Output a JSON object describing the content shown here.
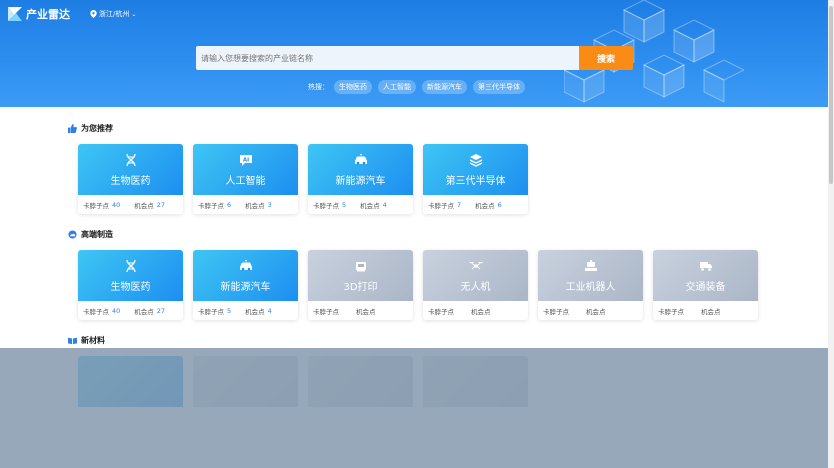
{
  "header": {
    "app_name": "产业雷达",
    "location": "浙江/杭州",
    "search_placeholder": "请输入您想要搜索的产业链名称",
    "search_button": "搜索",
    "hot_label": "热搜：",
    "hot_tags": [
      "生物医药",
      "人工智能",
      "新能源汽车",
      "第三代半导体"
    ]
  },
  "sections": [
    {
      "title": "为您推荐",
      "icon": "thumbs-up-icon",
      "cards": [
        {
          "name": "生物医药",
          "icon": "dna-icon",
          "style": "blue",
          "stat1_label": "卡脖子点",
          "stat1_value": "40",
          "stat2_label": "机会点",
          "stat2_value": "27"
        },
        {
          "name": "人工智能",
          "icon": "ai-icon",
          "style": "blue",
          "stat1_label": "卡脖子点",
          "stat1_value": "6",
          "stat2_label": "机会点",
          "stat2_value": "3"
        },
        {
          "name": "新能源汽车",
          "icon": "ev-car-icon",
          "style": "blue",
          "stat1_label": "卡脖子点",
          "stat1_value": "5",
          "stat2_label": "机会点",
          "stat2_value": "4"
        },
        {
          "name": "第三代半导体",
          "icon": "chip-layers-icon",
          "style": "blue",
          "stat1_label": "卡脖子点",
          "stat1_value": "7",
          "stat2_label": "机会点",
          "stat2_value": "6"
        }
      ]
    },
    {
      "title": "高端制造",
      "icon": "cloud-gear-icon",
      "cards": [
        {
          "name": "生物医药",
          "icon": "dna-icon",
          "style": "blue",
          "stat1_label": "卡脖子点",
          "stat1_value": "40",
          "stat2_label": "机会点",
          "stat2_value": "27"
        },
        {
          "name": "新能源汽车",
          "icon": "ev-car-icon",
          "style": "blue",
          "stat1_label": "卡脖子点",
          "stat1_value": "5",
          "stat2_label": "机会点",
          "stat2_value": "4"
        },
        {
          "name": "3D打印",
          "icon": "printer-3d-icon",
          "style": "gray",
          "stat1_label": "卡脖子点",
          "stat1_value": "",
          "stat2_label": "机会点",
          "stat2_value": ""
        },
        {
          "name": "无人机",
          "icon": "drone-icon",
          "style": "gray",
          "stat1_label": "卡脖子点",
          "stat1_value": "",
          "stat2_label": "机会点",
          "stat2_value": ""
        },
        {
          "name": "工业机器人",
          "icon": "robot-icon",
          "style": "gray",
          "stat1_label": "卡脖子点",
          "stat1_value": "",
          "stat2_label": "机会点",
          "stat2_value": ""
        },
        {
          "name": "交通装备",
          "icon": "truck-icon",
          "style": "gray",
          "stat1_label": "卡脖子点",
          "stat1_value": "",
          "stat2_label": "机会点",
          "stat2_value": ""
        }
      ]
    },
    {
      "title": "新材料",
      "icon": "book-icon",
      "cards": []
    }
  ],
  "colors": {
    "hero_blue": "#2f8ff0",
    "accent_orange": "#fa8c16",
    "number_blue": "#2f7fe6"
  }
}
